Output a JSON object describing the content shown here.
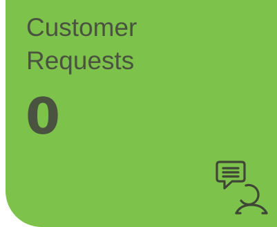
{
  "tile": {
    "title_line1": "Customer",
    "title_line2": "Requests",
    "count": "0",
    "icon": "customer-support-chat-icon",
    "background_color": "#7dc24b",
    "text_color": "#4a5240"
  }
}
